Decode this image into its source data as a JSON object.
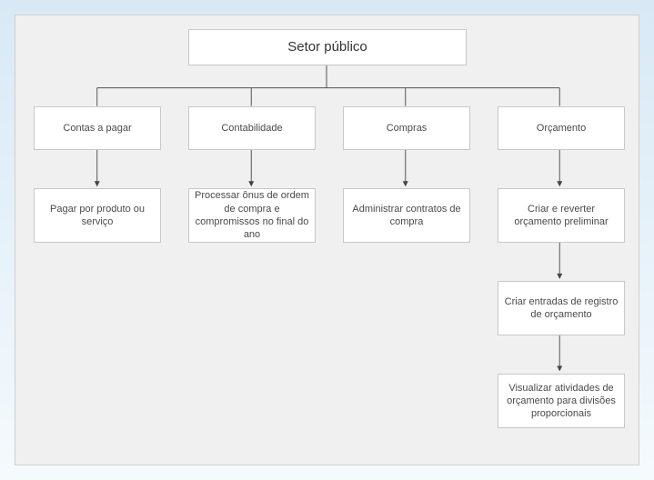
{
  "root": {
    "label": "Setor público"
  },
  "branches": {
    "ap": {
      "label": "Contas a pagar"
    },
    "gl": {
      "label": "Contabilidade"
    },
    "po": {
      "label": "Compras"
    },
    "bud": {
      "label": "Orçamento"
    }
  },
  "leaves": {
    "ap1": "Pagar por produto ou serviço",
    "gl1": "Processar ônus de ordem de compra e compromissos no final do ano",
    "po1": "Administrar contratos de compra",
    "bud1": "Criar e reverter orçamento preliminar",
    "bud2": "Criar entradas de registro de orçamento",
    "bud3": "Visualizar atividades de orçamento para divisões proporcionais"
  }
}
